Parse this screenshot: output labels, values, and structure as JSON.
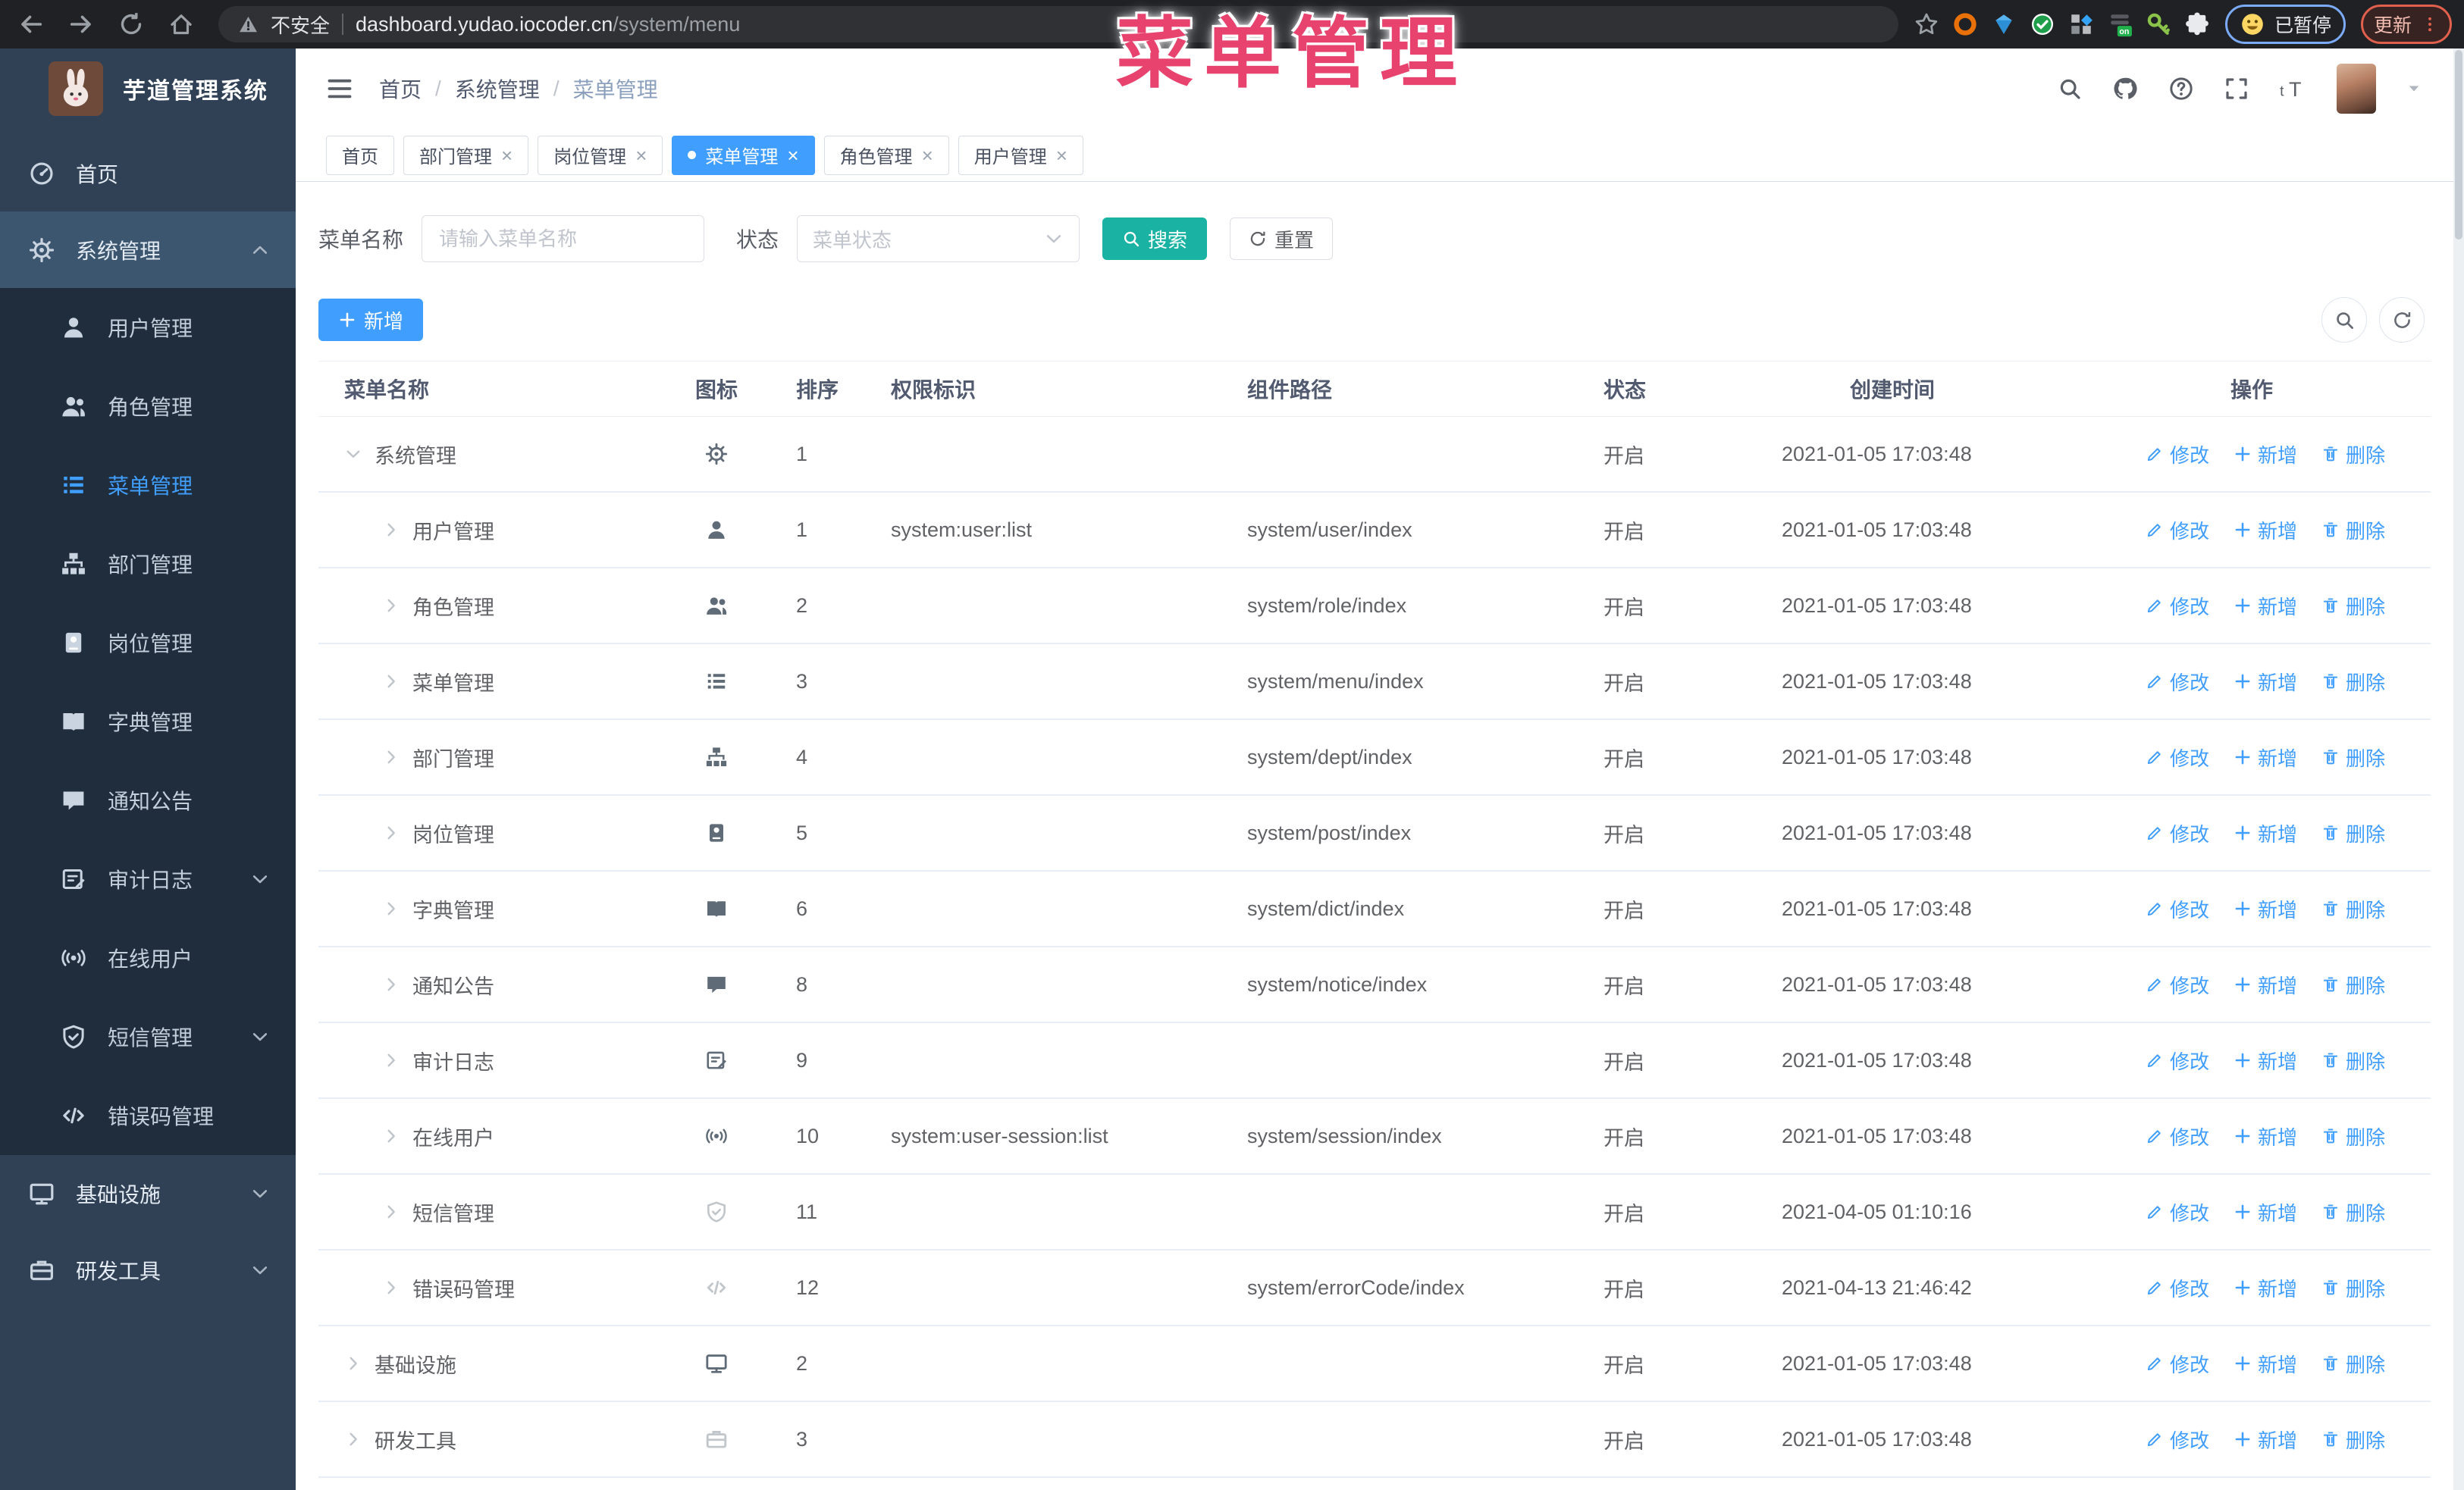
{
  "browser": {
    "security": "不安全",
    "domain": "dashboard.yudao.iocoder.cn",
    "path": "/system/menu",
    "paused": "已暂停",
    "update": "更新"
  },
  "overlay": {
    "text": "菜单管理",
    "color": "#e8436e"
  },
  "logo": {
    "title": "芋道管理系统"
  },
  "breadcrumb": [
    "首页",
    "系统管理",
    "菜单管理"
  ],
  "tabs": [
    {
      "label": "首页",
      "closable": false,
      "active": false
    },
    {
      "label": "部门管理",
      "closable": true,
      "active": false
    },
    {
      "label": "岗位管理",
      "closable": true,
      "active": false
    },
    {
      "label": "菜单管理",
      "closable": true,
      "active": true
    },
    {
      "label": "角色管理",
      "closable": true,
      "active": false
    },
    {
      "label": "用户管理",
      "closable": true,
      "active": false
    }
  ],
  "sidebar": {
    "items": [
      {
        "label": "首页",
        "icon": "dashboard",
        "level": 0
      },
      {
        "label": "系统管理",
        "icon": "gear",
        "level": 0,
        "arrow": "up",
        "open": true
      },
      {
        "label": "用户管理",
        "icon": "user",
        "level": 1
      },
      {
        "label": "角色管理",
        "icon": "peoples",
        "level": 1
      },
      {
        "label": "菜单管理",
        "icon": "menu",
        "level": 1,
        "active": true
      },
      {
        "label": "部门管理",
        "icon": "tree",
        "level": 1
      },
      {
        "label": "岗位管理",
        "icon": "post",
        "level": 1
      },
      {
        "label": "字典管理",
        "icon": "dict",
        "level": 1
      },
      {
        "label": "通知公告",
        "icon": "message",
        "level": 1
      },
      {
        "label": "审计日志",
        "icon": "log",
        "level": 1,
        "arrow": "down"
      },
      {
        "label": "在线用户",
        "icon": "online",
        "level": 1
      },
      {
        "label": "短信管理",
        "icon": "sms",
        "level": 1,
        "arrow": "down"
      },
      {
        "label": "错误码管理",
        "icon": "code",
        "level": 1
      },
      {
        "label": "基础设施",
        "icon": "monitor",
        "level": 0,
        "arrow": "down"
      },
      {
        "label": "研发工具",
        "icon": "tool",
        "level": 0,
        "arrow": "down"
      }
    ]
  },
  "search": {
    "name_label": "菜单名称",
    "name_placeholder": "请输入菜单名称",
    "status_label": "状态",
    "status_placeholder": "菜单状态",
    "search_label": "搜索",
    "reset_label": "重置"
  },
  "toolbar": {
    "add_label": "新增"
  },
  "table": {
    "headers": [
      "菜单名称",
      "图标",
      "排序",
      "权限标识",
      "组件路径",
      "状态",
      "创建时间",
      "操作"
    ],
    "ops": [
      {
        "icon": "edit",
        "label": "修改"
      },
      {
        "icon": "plus",
        "label": "新增"
      },
      {
        "icon": "delete",
        "label": "删除"
      }
    ],
    "rows": [
      {
        "level": 0,
        "caret": "down",
        "icon": "gear",
        "name": "系统管理",
        "sort": "1",
        "perm": "",
        "path": "",
        "status": "开启",
        "time": "2021-01-05 17:03:48"
      },
      {
        "level": 1,
        "caret": "right",
        "icon": "user",
        "name": "用户管理",
        "sort": "1",
        "perm": "system:user:list",
        "path": "system/user/index",
        "status": "开启",
        "time": "2021-01-05 17:03:48"
      },
      {
        "level": 1,
        "caret": "right",
        "icon": "peoples",
        "name": "角色管理",
        "sort": "2",
        "perm": "",
        "path": "system/role/index",
        "status": "开启",
        "time": "2021-01-05 17:03:48"
      },
      {
        "level": 1,
        "caret": "right",
        "icon": "menu",
        "name": "菜单管理",
        "sort": "3",
        "perm": "",
        "path": "system/menu/index",
        "status": "开启",
        "time": "2021-01-05 17:03:48"
      },
      {
        "level": 1,
        "caret": "right",
        "icon": "tree",
        "name": "部门管理",
        "sort": "4",
        "perm": "",
        "path": "system/dept/index",
        "status": "开启",
        "time": "2021-01-05 17:03:48"
      },
      {
        "level": 1,
        "caret": "right",
        "icon": "post",
        "name": "岗位管理",
        "sort": "5",
        "perm": "",
        "path": "system/post/index",
        "status": "开启",
        "time": "2021-01-05 17:03:48"
      },
      {
        "level": 1,
        "caret": "right",
        "icon": "dict",
        "name": "字典管理",
        "sort": "6",
        "perm": "",
        "path": "system/dict/index",
        "status": "开启",
        "time": "2021-01-05 17:03:48"
      },
      {
        "level": 1,
        "caret": "right",
        "icon": "message",
        "name": "通知公告",
        "sort": "8",
        "perm": "",
        "path": "system/notice/index",
        "status": "开启",
        "time": "2021-01-05 17:03:48"
      },
      {
        "level": 1,
        "caret": "right",
        "icon": "log",
        "name": "审计日志",
        "sort": "9",
        "perm": "",
        "path": "",
        "status": "开启",
        "time": "2021-01-05 17:03:48"
      },
      {
        "level": 1,
        "caret": "right",
        "icon": "online",
        "name": "在线用户",
        "sort": "10",
        "perm": "system:user-session:list",
        "path": "system/session/index",
        "status": "开启",
        "time": "2021-01-05 17:03:48"
      },
      {
        "level": 1,
        "caret": "right",
        "icon": "sms",
        "name": "短信管理",
        "sort": "11",
        "perm": "",
        "path": "",
        "status": "开启",
        "time": "2021-04-05 01:10:16",
        "faded": true
      },
      {
        "level": 1,
        "caret": "right",
        "icon": "code",
        "name": "错误码管理",
        "sort": "12",
        "perm": "",
        "path": "system/errorCode/index",
        "status": "开启",
        "time": "2021-04-13 21:46:42",
        "faded": true
      },
      {
        "level": 0,
        "caret": "right",
        "icon": "monitor",
        "name": "基础设施",
        "sort": "2",
        "perm": "",
        "path": "",
        "status": "开启",
        "time": "2021-01-05 17:03:48"
      },
      {
        "level": 0,
        "caret": "right",
        "icon": "tool",
        "name": "研发工具",
        "sort": "3",
        "perm": "",
        "path": "",
        "status": "开启",
        "time": "2021-01-05 17:03:48",
        "faded": true
      }
    ]
  },
  "colors": {
    "primary": "#409eff",
    "search_button": "#1ab3a3",
    "sidebar_bg": "#304156",
    "submenu_bg": "#1f2d3d",
    "chrome_bg": "#202124"
  }
}
